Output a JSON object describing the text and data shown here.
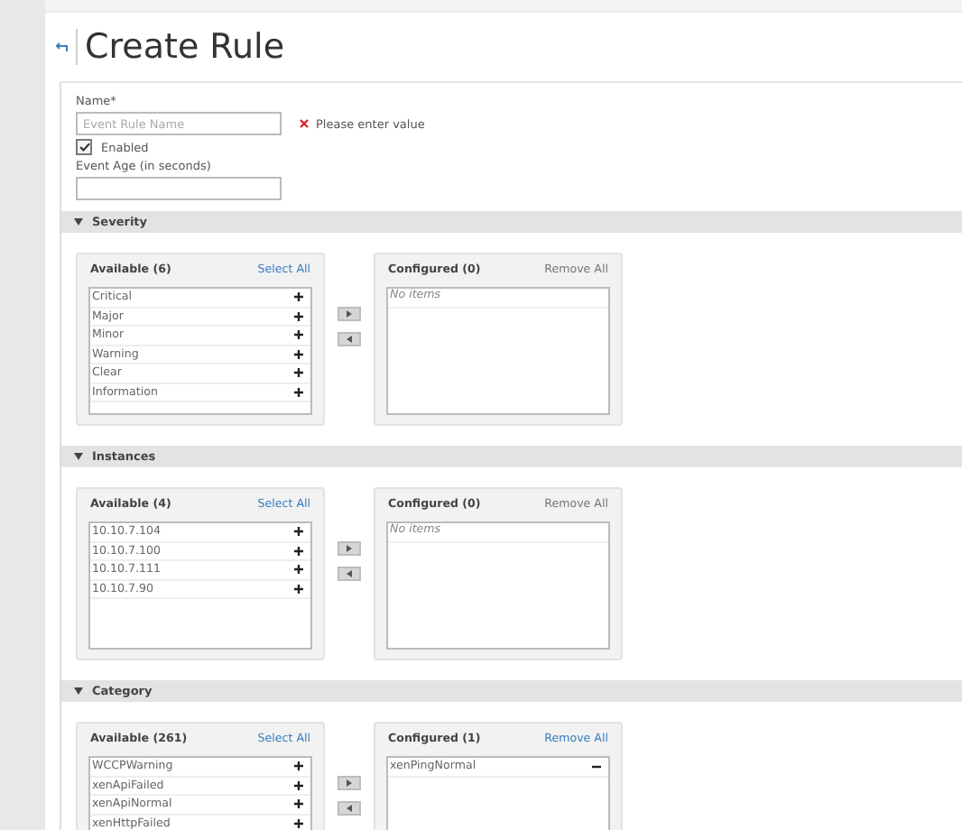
{
  "page": {
    "title": "Create Rule"
  },
  "form": {
    "name_label": "Name*",
    "name_placeholder": "Event Rule Name",
    "error": "Please enter value",
    "enabled": {
      "label": "Enabled",
      "checked": true
    },
    "age_label": "Event Age (in seconds)"
  },
  "sections": [
    {
      "title": "Severity",
      "expanded": true,
      "available": {
        "title": "Available (6)",
        "action": "Select All",
        "action_disabled": false,
        "items": [
          "Critical",
          "Major",
          "Minor",
          "Warning",
          "Clear",
          "Information"
        ]
      },
      "configured": {
        "title": "Configured (0)",
        "action": "Remove All",
        "action_disabled": true,
        "empty": "No items"
      }
    },
    {
      "title": "Instances",
      "expanded": true,
      "available": {
        "title": "Available (4)",
        "action": "Select All",
        "action_disabled": false,
        "items": [
          "10.10.7.104",
          "10.10.7.100",
          "10.10.7.111",
          "10.10.7.90"
        ]
      },
      "configured": {
        "title": "Configured (0)",
        "action": "Remove All",
        "action_disabled": true,
        "empty": "No items"
      }
    },
    {
      "title": "Category",
      "expanded": true,
      "available": {
        "title": "Available (261)",
        "action": "Select All",
        "action_disabled": false,
        "items": [
          "WCCPWarning",
          "xenApiFailed",
          "xenApiNormal",
          "xenHttpFailed"
        ]
      },
      "configured": {
        "title": "Configured (1)",
        "action": "Remove All",
        "action_disabled": false,
        "items": [
          "xenPingNormal"
        ]
      }
    }
  ]
}
